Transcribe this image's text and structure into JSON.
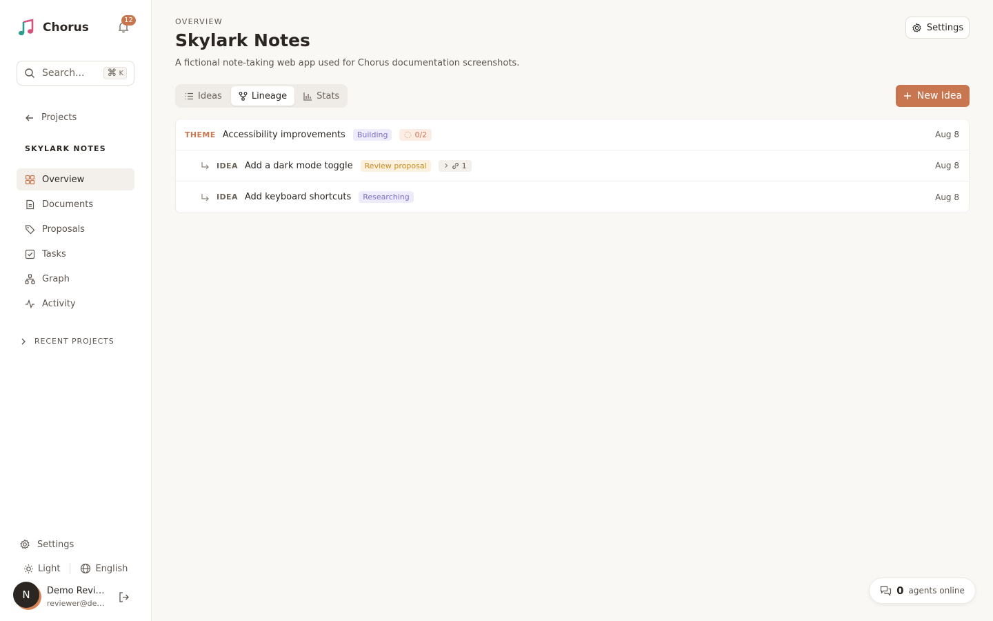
{
  "brand": {
    "name": "Chorus"
  },
  "notifications": {
    "count": "12"
  },
  "search": {
    "placeholder": "Search...",
    "shortcut_key": "K"
  },
  "sidebar": {
    "back_label": "Projects",
    "project_heading": "SKYLARK NOTES",
    "items": [
      {
        "label": "Overview",
        "icon": "overview-icon",
        "active": true
      },
      {
        "label": "Documents",
        "icon": "document-icon"
      },
      {
        "label": "Proposals",
        "icon": "tag-icon"
      },
      {
        "label": "Tasks",
        "icon": "checkbox-icon"
      },
      {
        "label": "Graph",
        "icon": "graph-icon"
      },
      {
        "label": "Activity",
        "icon": "activity-icon"
      }
    ],
    "recent_label": "RECENT PROJECTS",
    "settings_label": "Settings",
    "theme_label": "Light",
    "language_label": "English",
    "user": {
      "initial": "N",
      "name": "Demo Reviewer",
      "email": "reviewer@demo.com"
    }
  },
  "header": {
    "overline": "OVERVIEW",
    "title": "Skylark Notes",
    "description": "A fictional note-taking web app used for Chorus documentation screenshots.",
    "settings_label": "Settings"
  },
  "tabs": [
    {
      "label": "Ideas",
      "icon": "list-icon",
      "active": false
    },
    {
      "label": "Lineage",
      "icon": "lineage-icon",
      "active": true
    },
    {
      "label": "Stats",
      "icon": "bar-chart-icon",
      "active": false
    }
  ],
  "new_button": {
    "label": "New Idea"
  },
  "rows": [
    {
      "kind": "THEME",
      "title": "Accessibility improvements",
      "status": "Building",
      "chip": "0/2",
      "date": "Aug 8"
    },
    {
      "kind": "IDEA",
      "title": "Add a dark mode toggle",
      "status": "Review proposal",
      "chip": "1",
      "date": "Aug 8"
    },
    {
      "kind": "IDEA",
      "title": "Add keyboard shortcuts",
      "status": "Researching",
      "date": "Aug 8"
    }
  ],
  "agents": {
    "count": "0",
    "label": "agents online"
  },
  "colors": {
    "accent": "#c87650",
    "building": "#7b6fc7",
    "review": "#c98a1e",
    "researching": "#7b6fc7"
  }
}
